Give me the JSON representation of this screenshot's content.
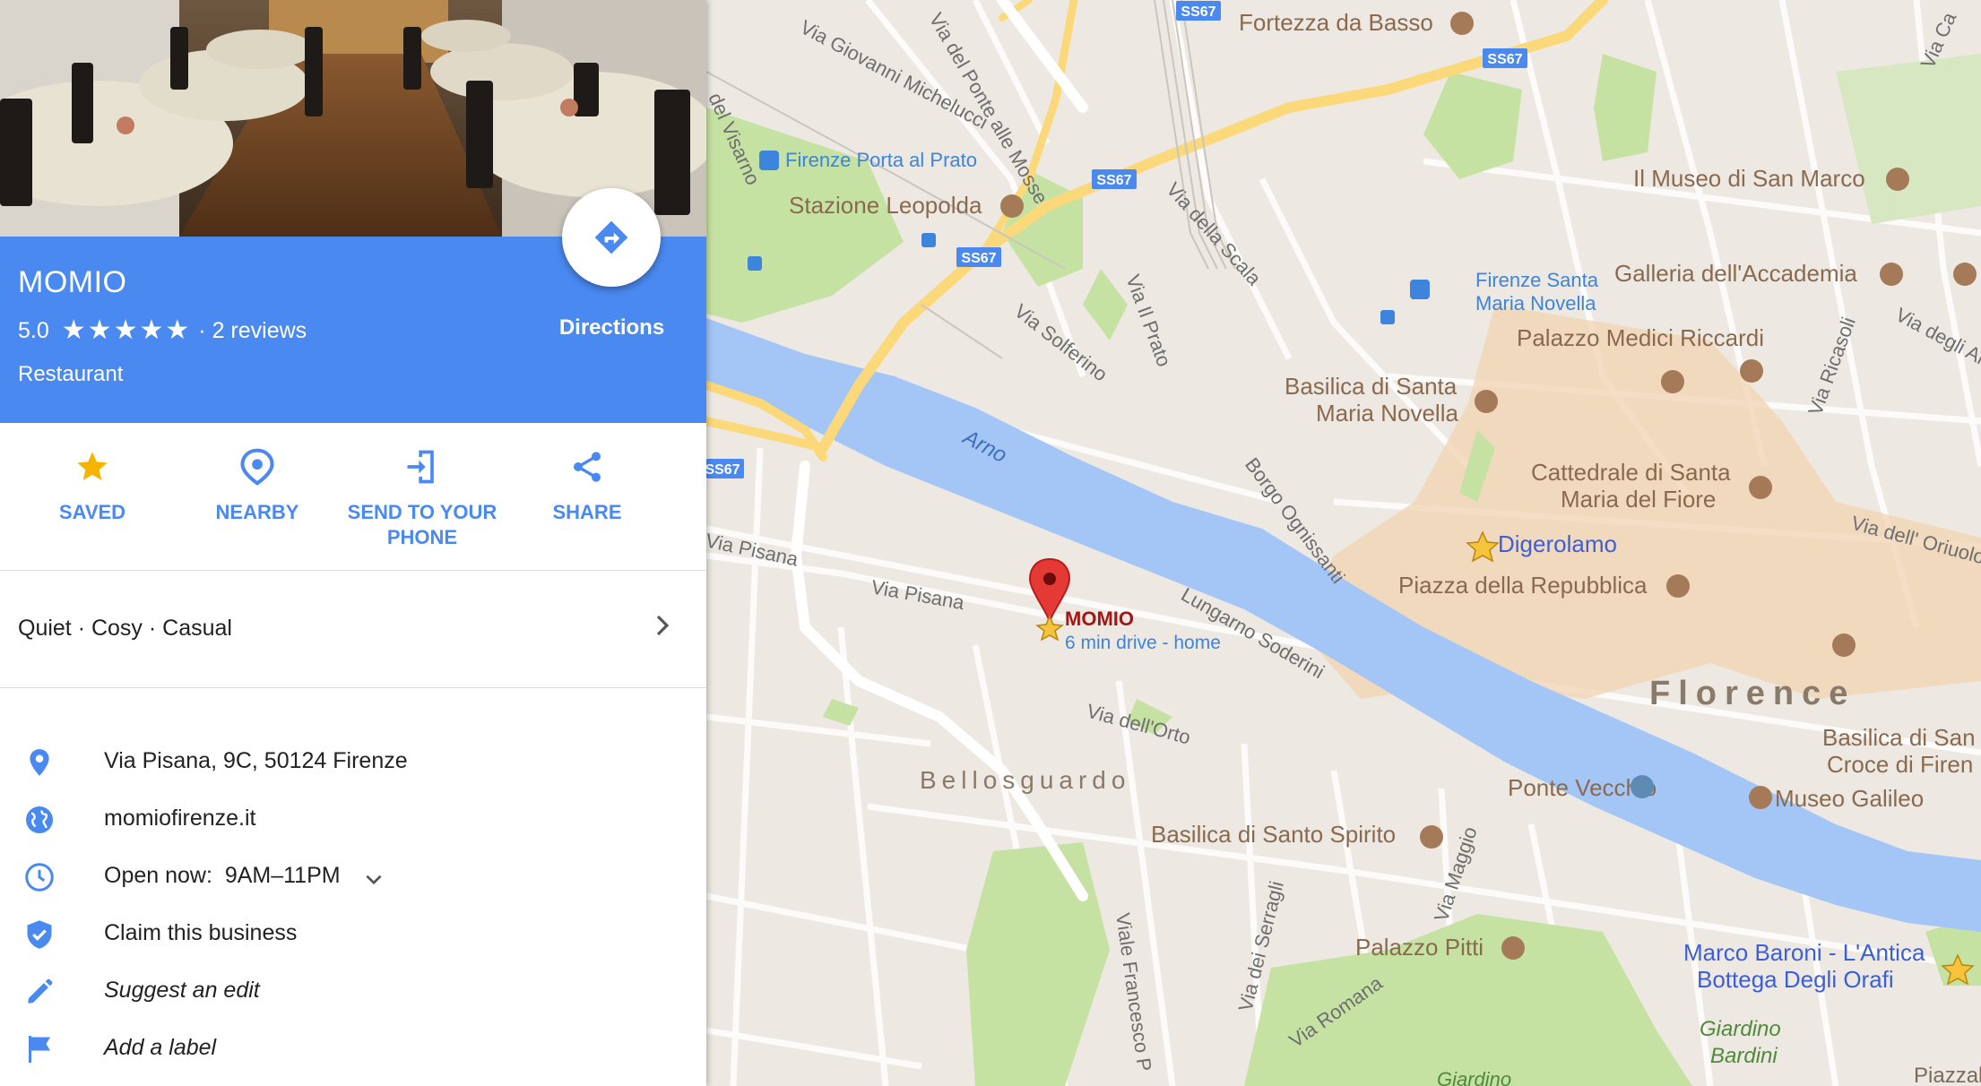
{
  "place": {
    "name": "MOMIO",
    "rating": "5.0",
    "stars": [
      "★",
      "★",
      "★",
      "★",
      "★"
    ],
    "reviews": "· 2 reviews",
    "category": "Restaurant",
    "directions_label": "Directions"
  },
  "actions": [
    {
      "id": "saved",
      "label": "SAVED",
      "icon": "star-icon"
    },
    {
      "id": "nearby",
      "label": "NEARBY",
      "icon": "nearby-icon"
    },
    {
      "id": "send",
      "label_line1": "SEND TO YOUR",
      "label_line2": "PHONE",
      "icon": "send-to-phone-icon"
    },
    {
      "id": "share",
      "label": "SHARE",
      "icon": "share-icon"
    }
  ],
  "atmosphere": "Quiet · Cosy · Casual",
  "info": {
    "address": "Via Pisana, 9C, 50124 Firenze",
    "website": "momiofirenze.it",
    "hours_prefix": "Open now:",
    "hours_value": "9AM–11PM",
    "claim": "Claim this business",
    "suggest": "Suggest an edit",
    "label": "Add a label"
  },
  "colors": {
    "accent": "#4a89f0",
    "river": "#a4c6f6",
    "park": "#c6e2a3",
    "road_major": "#fbd97a",
    "historic": "#f2d3b1",
    "marker": "#e53935"
  },
  "map": {
    "pin_label": "MOMIO",
    "pin_sublabel": "6 min drive - home",
    "road_shields": [
      "SS67",
      "SS67",
      "SS67",
      "SS67",
      "SS67"
    ],
    "labels": {
      "fortezza": "Fortezza da Basso",
      "porta_prato": "Firenze Porta al Prato",
      "leopolda": "Stazione Leopolda",
      "museo_marco": "Il Museo di San Marco",
      "accademia": "Galleria dell'Accademia",
      "smn_1": "Firenze Santa",
      "smn_2": "Maria Novella",
      "medici": "Palazzo Medici Riccardi",
      "basilica_smn_1": "Basilica di Santa",
      "basilica_smn_2": "Maria Novella",
      "cattedrale_1": "Cattedrale di Santa",
      "cattedrale_2": "Maria del Fiore",
      "digerolamo": "Digerolamo",
      "repubblica": "Piazza della Repubblica",
      "florence": "Florence",
      "bellosguardo": "Bellosguardo",
      "ponte_vecchio": "Ponte Vecchio",
      "santa_croce_1": "Basilica di San",
      "santa_croce_2": "Croce di Firen",
      "galileo": "Museo Galileo",
      "santo_spirito": "Basilica di Santo Spirito",
      "pitti": "Palazzo Pitti",
      "baroni_1": "Marco Baroni - L'Antica",
      "baroni_2": "Bottega Degli Orafi",
      "bardini_1": "Giardino",
      "bardini_2": "Bardini",
      "arno": "Arno",
      "via_michelucci": "Via Giovanni Michelucci",
      "via_ponte_mosse": "Via del Ponte alle Mosse",
      "via_scala": "Via della Scala",
      "via_prato": "Via Il Prato",
      "via_solferino": "Via Solferino",
      "via_pisana_1": "Via Pisana",
      "via_pisana_2": "Via Pisana",
      "borgo_ognissanti": "Borgo Ognissanti",
      "lungarno_soderini": "Lungarno Soderini",
      "via_orto": "Via dell'Orto",
      "via_ricasoli": "Via Ricasoli",
      "via_alfani": "Via degli Al",
      "via_oriuolo": "Via dell' Oriuolo",
      "via_maggio": "Via Maggio",
      "via_serragli": "Via dei Serragli",
      "via_romana": "Via Romana",
      "viale_petrarca": "Viale Francesco P",
      "via_visarno": "del Visarno",
      "via_ca": "Via Ca",
      "piazzale": "Piazzale M",
      "giardino_bottom": "Giardino"
    }
  }
}
